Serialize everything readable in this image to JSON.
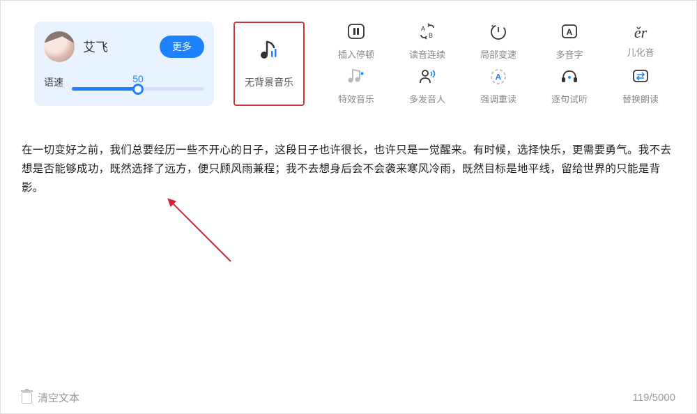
{
  "voice": {
    "name": "艾飞",
    "more_btn": "更多",
    "speed_label": "语速",
    "speed_value": "50"
  },
  "music": {
    "label": "无背景音乐"
  },
  "tools": {
    "row1": [
      {
        "id": "insert-pause",
        "label": "插入停顿"
      },
      {
        "id": "continuous",
        "label": "读音连续"
      },
      {
        "id": "local-speed",
        "label": "局部变速"
      },
      {
        "id": "polyphone",
        "label": "多音字"
      },
      {
        "id": "erhua",
        "label": "儿化音"
      }
    ],
    "row2": [
      {
        "id": "sfx",
        "label": "特效音乐"
      },
      {
        "id": "multi-speaker",
        "label": "多发音人"
      },
      {
        "id": "emphasis",
        "label": "强调重读"
      },
      {
        "id": "sentence-try",
        "label": "逐句试听"
      },
      {
        "id": "replace-read",
        "label": "替换朗读"
      }
    ]
  },
  "content_text": "在一切变好之前，我们总要经历一些不开心的日子，这段日子也许很长，也许只是一觉醒来。有时候，选择快乐，更需要勇气。我不去想是否能够成功，既然选择了远方，便只顾风雨兼程；我不去想身后会不会袭来寒风冷雨，既然目标是地平线，留给世界的只能是背影。",
  "footer": {
    "clear": "清空文本",
    "counter": "119/5000"
  },
  "icons": {
    "er_glyph": "ěr"
  },
  "colors": {
    "accent_blue": "#1e82ff",
    "highlight_red": "#c23b3b"
  }
}
